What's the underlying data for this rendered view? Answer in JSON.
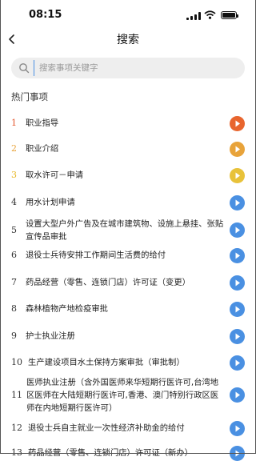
{
  "status_bar": {
    "time": "08:15"
  },
  "header": {
    "title": "搜索"
  },
  "search": {
    "placeholder": "搜索事项关键字"
  },
  "section_title": "热门事项",
  "colors": {
    "rank_1": "#e4552b",
    "rank_2": "#e8a33a",
    "rank_3": "#e8b828",
    "default_num": "#333333",
    "play_blue": "#4a90e2"
  },
  "items": [
    {
      "num": "1",
      "label": "职业指导",
      "play_color": "#e8652e"
    },
    {
      "num": "2",
      "label": "职业介绍",
      "play_color": "#e8a33a"
    },
    {
      "num": "3",
      "label": "取水许可－申请",
      "play_color": "#e8c23a"
    },
    {
      "num": "4",
      "label": "用水计划申请",
      "play_color": "#4a90e2"
    },
    {
      "num": "5",
      "label": "设置大型户外广告及在城市建筑物、设施上悬挂、张贴宣传品审批",
      "play_color": "#4a90e2"
    },
    {
      "num": "6",
      "label": "退役士兵待安排工作期间生活费的给付",
      "play_color": "#4a90e2"
    },
    {
      "num": "7",
      "label": "药品经营（零售、连锁门店）许可证（变更）",
      "play_color": "#4a90e2"
    },
    {
      "num": "8",
      "label": "森林植物产地检疫审批",
      "play_color": "#4a90e2"
    },
    {
      "num": "9",
      "label": "护士执业注册",
      "play_color": "#4a90e2"
    },
    {
      "num": "10",
      "label": "生产建设项目水土保持方案审批（审批制）",
      "play_color": "#4a90e2"
    },
    {
      "num": "11",
      "label": "医师执业注册（含外国医师来华短期行医许可,台湾地区医师在大陆短期行医许可,香港、澳门特别行政区医师在内地短期行医许可）",
      "play_color": "#4a90e2"
    },
    {
      "num": "12",
      "label": "退役士兵自主就业一次性经济补助金的给付",
      "play_color": "#4a90e2"
    },
    {
      "num": "13",
      "label": "药品经营（零售、连锁门店）许可证（新办）",
      "play_color": "#4a90e2"
    }
  ]
}
